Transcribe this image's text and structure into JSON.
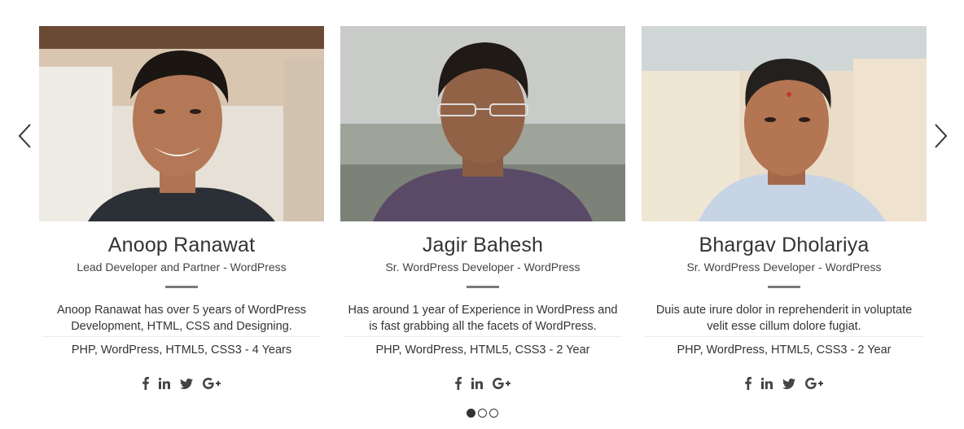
{
  "carousel": {
    "prev_icon": "chevron-left-icon",
    "next_icon": "chevron-right-icon",
    "pages": 3,
    "active_page": 1
  },
  "team": [
    {
      "name": "Anoop Ranawat",
      "role": "Lead Developer and Partner - WordPress",
      "bio": "Anoop Ranawat has over 5 years of WordPress Development, HTML, CSS and Designing.",
      "skills": "PHP, WordPress, HTML5, CSS3 - 4 Years",
      "social": [
        "facebook-icon",
        "linkedin-icon",
        "twitter-icon",
        "google-plus-icon"
      ]
    },
    {
      "name": "Jagir Bahesh",
      "role": "Sr. WordPress Developer - WordPress",
      "bio": "Has around 1 year of Experience in WordPress and is fast grabbing all the facets of WordPress.",
      "skills": "PHP, WordPress, HTML5, CSS3 - 2 Year",
      "social": [
        "facebook-icon",
        "linkedin-icon",
        "google-plus-icon"
      ]
    },
    {
      "name": "Bhargav Dholariya",
      "role": "Sr. WordPress Developer - WordPress",
      "bio": "Duis aute irure dolor in reprehenderit in voluptate velit esse cillum dolore fugiat.",
      "skills": "PHP, WordPress, HTML5, CSS3 - 2 Year",
      "social": [
        "facebook-icon",
        "linkedin-icon",
        "twitter-icon",
        "google-plus-icon"
      ]
    }
  ],
  "colors": {
    "text": "#333333",
    "divider": "#7a7a7a",
    "icon": "#444444"
  }
}
